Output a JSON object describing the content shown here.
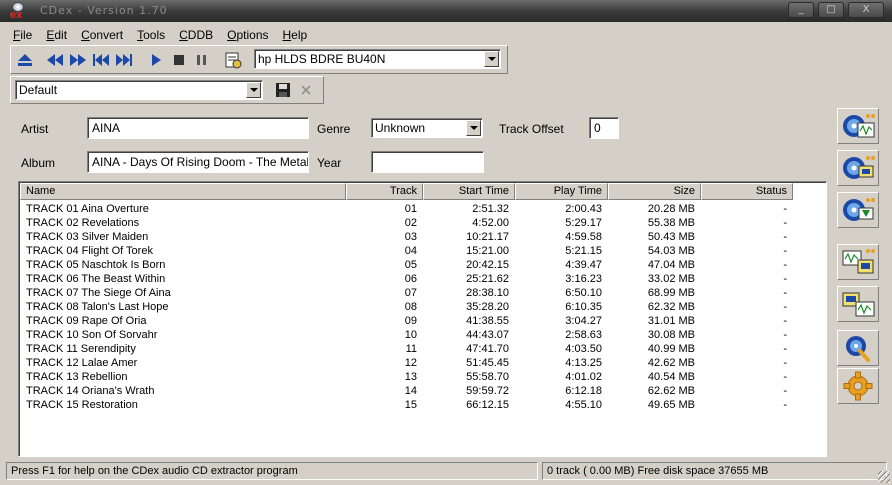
{
  "window": {
    "title": "CDex - Version 1.70",
    "buttons": [
      "_",
      "□",
      "X"
    ]
  },
  "menu": [
    {
      "label": "File",
      "accel": "F",
      "rest": "ile"
    },
    {
      "label": "Edit",
      "accel": "E",
      "rest": "dit"
    },
    {
      "label": "Convert",
      "accel": "C",
      "rest": "onvert"
    },
    {
      "label": "Tools",
      "accel": "T",
      "rest": "ools"
    },
    {
      "label": "CDDB",
      "accel": "C",
      "rest": "DDB"
    },
    {
      "label": "Options",
      "accel": "O",
      "rest": "ptions"
    },
    {
      "label": "Help",
      "accel": "H",
      "rest": "elp"
    }
  ],
  "toolbar": {
    "drive": "hp HLDS BDRE   BU40N",
    "profile": "Default"
  },
  "form": {
    "artist_label": "Artist",
    "artist_value": "AINA",
    "album_label": "Album",
    "album_value": "AINA - Days Of Rising Doom - The Metal Opera",
    "genre_label": "Genre",
    "genre_value": "Unknown",
    "year_label": "Year",
    "year_value": "",
    "offset_label": "Track Offset",
    "offset_value": "0"
  },
  "table": {
    "columns": [
      "Name",
      "Track",
      "Start Time",
      "Play Time",
      "Size",
      "Status"
    ],
    "rows": [
      {
        "name": "TRACK 01  Aina Overture",
        "track": "01",
        "start": "2:51.32",
        "play": "2:00.43",
        "size": "20.28 MB",
        "status": "-"
      },
      {
        "name": "TRACK 02  Revelations",
        "track": "02",
        "start": "4:52.00",
        "play": "5:29.17",
        "size": "55.38 MB",
        "status": "-"
      },
      {
        "name": "TRACK 03  Silver Maiden",
        "track": "03",
        "start": "10:21.17",
        "play": "4:59.58",
        "size": "50.43 MB",
        "status": "-"
      },
      {
        "name": "TRACK 04  Flight Of Torek",
        "track": "04",
        "start": "15:21.00",
        "play": "5:21.15",
        "size": "54.03 MB",
        "status": "-"
      },
      {
        "name": "TRACK 05  Naschtok Is Born",
        "track": "05",
        "start": "20:42.15",
        "play": "4:39.47",
        "size": "47.04 MB",
        "status": "-"
      },
      {
        "name": "TRACK 06  The Beast Within",
        "track": "06",
        "start": "25:21.62",
        "play": "3:16.23",
        "size": "33.02 MB",
        "status": "-"
      },
      {
        "name": "TRACK 07  The Siege Of Aina",
        "track": "07",
        "start": "28:38.10",
        "play": "6:50.10",
        "size": "68.99 MB",
        "status": "-"
      },
      {
        "name": "TRACK 08  Talon's Last Hope",
        "track": "08",
        "start": "35:28.20",
        "play": "6:10.35",
        "size": "62.32 MB",
        "status": "-"
      },
      {
        "name": "TRACK 09  Rape Of Oria",
        "track": "09",
        "start": "41:38.55",
        "play": "3:04.27",
        "size": "31.01 MB",
        "status": "-"
      },
      {
        "name": "TRACK 10  Son Of Sorvahr",
        "track": "10",
        "start": "44:43.07",
        "play": "2:58.63",
        "size": "30.08 MB",
        "status": "-"
      },
      {
        "name": "TRACK 11  Serendipity",
        "track": "11",
        "start": "47:41.70",
        "play": "4:03.50",
        "size": "40.99 MB",
        "status": "-"
      },
      {
        "name": "TRACK 12  Lalae Amer",
        "track": "12",
        "start": "51:45.45",
        "play": "4:13.25",
        "size": "42.62 MB",
        "status": "-"
      },
      {
        "name": "TRACK 13  Rebellion",
        "track": "13",
        "start": "55:58.70",
        "play": "4:01.02",
        "size": "40.54 MB",
        "status": "-"
      },
      {
        "name": "TRACK 14  Oriana's Wrath",
        "track": "14",
        "start": "59:59.72",
        "play": "6:12.18",
        "size": "62.62 MB",
        "status": "-"
      },
      {
        "name": "TRACK 15  Restoration",
        "track": "15",
        "start": "66:12.15",
        "play": "4:55.10",
        "size": "49.65 MB",
        "status": "-"
      }
    ]
  },
  "status": {
    "help": "Press F1 for help on the CDex audio CD extractor program",
    "info": "0 track ( 0.00 MB) Free disk space 37655 MB"
  },
  "side_buttons": [
    "extract-cd-to-wav-icon",
    "extract-cd-to-mp3-icon",
    "extract-partial-track-icon",
    "convert-wav-to-mp3-icon",
    "convert-mp3-to-wav-icon",
    "cddb-lookup-icon",
    "configure-icon"
  ],
  "colors": {
    "window_bg": "#d4d0c8",
    "accent_blue": "#1c49a8",
    "logo_red": "#e8281e"
  }
}
